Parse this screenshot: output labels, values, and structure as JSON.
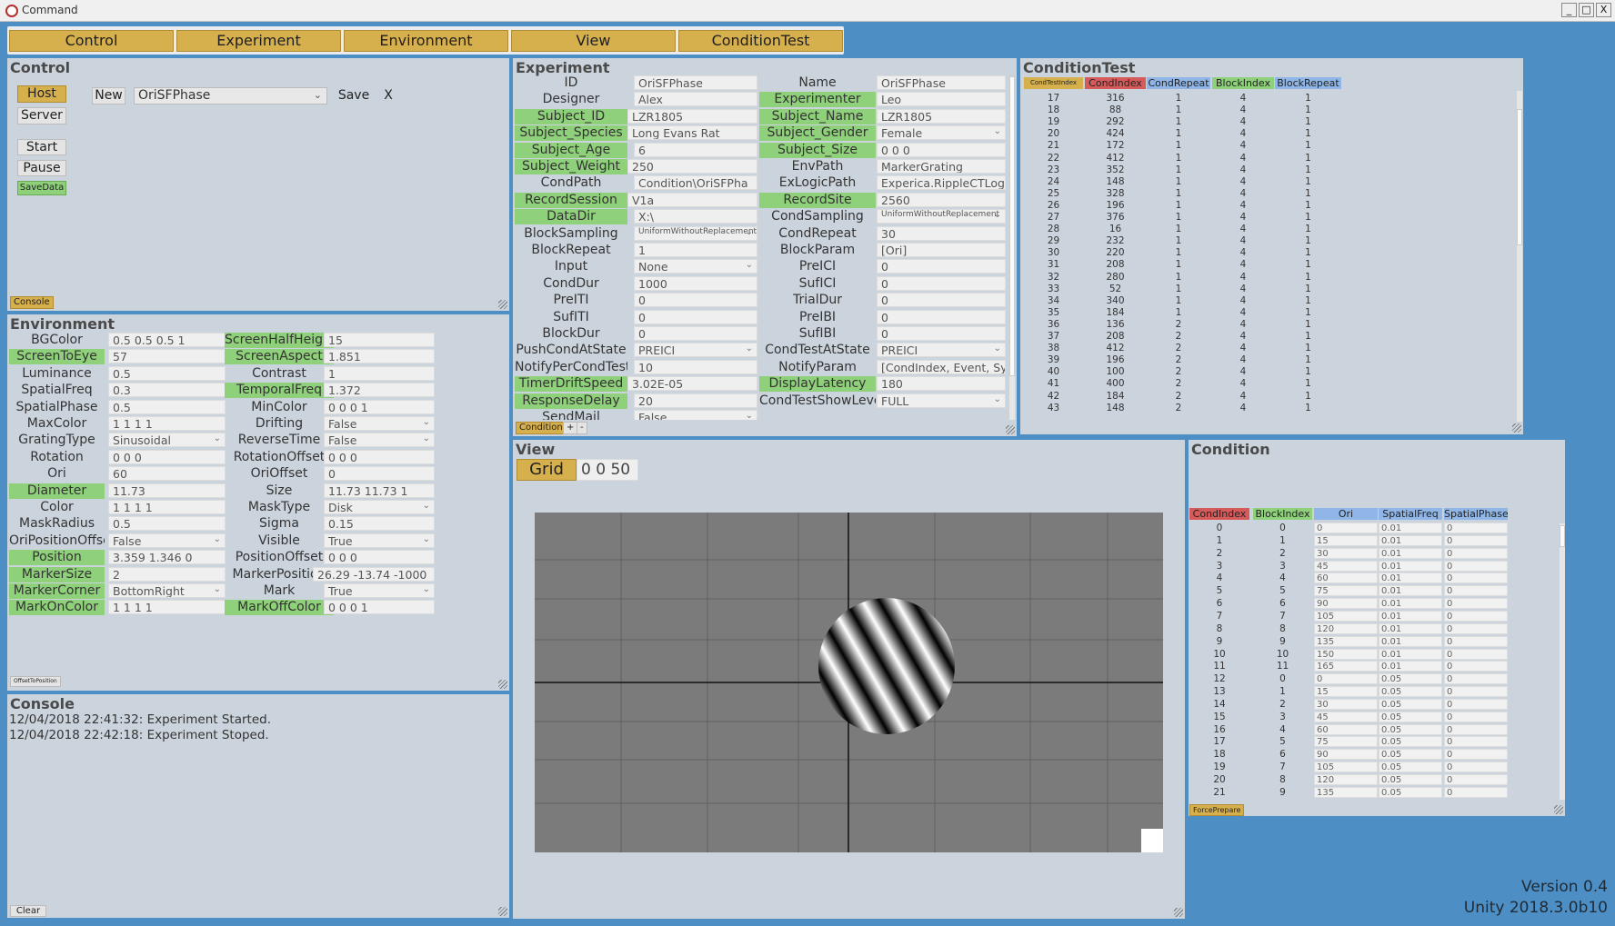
{
  "window": {
    "title": "Command",
    "min": "_",
    "max": "□",
    "close": "X"
  },
  "menu": [
    "Control",
    "Experiment",
    "Environment",
    "View",
    "ConditionTest"
  ],
  "control": {
    "title": "Control",
    "host": "Host",
    "server": "Server",
    "new": "New",
    "experiment": "OriSFPhase",
    "save": "Save",
    "close": "X",
    "start": "Start",
    "pause": "Pause",
    "savedata": "SaveData",
    "console_tab": "Console"
  },
  "environment": {
    "title": "Environment",
    "footer_tab": "OffsetToPosition",
    "rows": [
      [
        "BGColor",
        "0.5 0.5 0.5 1",
        false,
        "ScreenHalfHeight",
        "15",
        true
      ],
      [
        "ScreenToEye",
        "57",
        true,
        "ScreenAspect",
        "1.851",
        true
      ],
      [
        "Luminance",
        "0.5",
        false,
        "Contrast",
        "1",
        false
      ],
      [
        "SpatialFreq",
        "0.3",
        false,
        "TemporalFreq",
        "1.372",
        true
      ],
      [
        "SpatialPhase",
        "0.5",
        false,
        "MinColor",
        "0 0 0 1",
        false
      ],
      [
        "MaxColor",
        "1 1 1 1",
        false,
        "Drifting",
        "False",
        false
      ],
      [
        "GratingType",
        "Sinusoidal",
        false,
        "ReverseTime",
        "False",
        false
      ],
      [
        "Rotation",
        "0 0 0",
        false,
        "RotationOffset",
        "0 0 0",
        false
      ],
      [
        "Ori",
        "60",
        false,
        "OriOffset",
        "0",
        false
      ],
      [
        "Diameter",
        "11.73",
        true,
        "Size",
        "11.73 11.73 1",
        false
      ],
      [
        "Color",
        "1 1 1 1",
        false,
        "MaskType",
        "Disk",
        false
      ],
      [
        "MaskRadius",
        "0.5",
        false,
        "Sigma",
        "0.15",
        false
      ],
      [
        "OriPositionOffset",
        "False",
        false,
        "Visible",
        "True",
        false
      ],
      [
        "Position",
        "3.359 1.346 0",
        true,
        "PositionOffset",
        "0 0 0",
        false
      ],
      [
        "MarkerSize",
        "2",
        true,
        "MarkerPosition",
        "26.29 -13.74 -1000",
        false
      ],
      [
        "MarkerCorner",
        "BottomRight",
        true,
        "Mark",
        "True",
        false
      ],
      [
        "MarkOnColor",
        "1 1 1 1",
        true,
        "MarkOffColor",
        "0 0 0 1",
        true
      ]
    ]
  },
  "console": {
    "title": "Console",
    "lines": [
      "12/04/2018 22:41:32:  Experiment Started.",
      "12/04/2018 22:42:18:  Experiment Stoped."
    ],
    "clear": "Clear"
  },
  "experiment": {
    "title": "Experiment",
    "tab": "Condition",
    "plus": "+",
    "minus": "-",
    "rows": [
      [
        "ID",
        "OriSFPhase",
        false,
        "Name",
        "OriSFPhase",
        false
      ],
      [
        "Designer",
        "Alex",
        false,
        "Experimenter",
        "Leo",
        true
      ],
      [
        "Subject_ID",
        "LZR1805",
        true,
        "Subject_Name",
        "LZR1805",
        true
      ],
      [
        "Subject_Species",
        "Long Evans Rat",
        true,
        "Subject_Gender",
        "Female",
        true
      ],
      [
        "Subject_Age",
        "6",
        true,
        "Subject_Size",
        "0 0 0",
        true
      ],
      [
        "Subject_Weight",
        "250",
        true,
        "EnvPath",
        "MarkerGrating",
        false
      ],
      [
        "CondPath",
        "Condition\\OriSFPha",
        false,
        "ExLogicPath",
        "Experica.RippleCTLogic",
        false
      ],
      [
        "RecordSession",
        "V1a",
        true,
        "RecordSite",
        "2560",
        true
      ],
      [
        "DataDir",
        "X:\\",
        true,
        "CondSampling",
        "UniformWithoutReplacement",
        false
      ],
      [
        "BlockSampling",
        "UniformWithoutReplacement",
        false,
        "CondRepeat",
        "30",
        false
      ],
      [
        "BlockRepeat",
        "1",
        false,
        "BlockParam",
        "[Ori]",
        false
      ],
      [
        "Input",
        "None",
        false,
        "PreICI",
        "0",
        false
      ],
      [
        "CondDur",
        "1000",
        false,
        "SufICI",
        "0",
        false
      ],
      [
        "PreITI",
        "0",
        false,
        "TrialDur",
        "0",
        false
      ],
      [
        "SufITI",
        "0",
        false,
        "PreIBI",
        "0",
        false
      ],
      [
        "BlockDur",
        "0",
        false,
        "SufIBI",
        "0",
        false
      ],
      [
        "PushCondAtState",
        "PREICI",
        false,
        "CondTestAtState",
        "PREICI",
        false
      ],
      [
        "NotifyPerCondTest",
        "10",
        false,
        "NotifyParam",
        "[CondIndex, Event, SyncEve",
        false
      ],
      [
        "TimerDriftSpeed",
        "3.02E-05",
        true,
        "DisplayLatency",
        "180",
        true
      ],
      [
        "ResponseDelay",
        "20",
        true,
        "CondTestShowLevel",
        "FULL",
        false
      ],
      [
        "SendMail",
        "False",
        false,
        "",
        "",
        false
      ]
    ]
  },
  "conditiontest": {
    "title": "ConditionTest",
    "headers": [
      "CondTestIndex",
      "CondIndex",
      "CondRepeat",
      "BlockIndex",
      "BlockRepeat"
    ],
    "rows": [
      [
        17,
        316,
        1,
        4,
        1
      ],
      [
        18,
        88,
        1,
        4,
        1
      ],
      [
        19,
        292,
        1,
        4,
        1
      ],
      [
        20,
        424,
        1,
        4,
        1
      ],
      [
        21,
        172,
        1,
        4,
        1
      ],
      [
        22,
        412,
        1,
        4,
        1
      ],
      [
        23,
        352,
        1,
        4,
        1
      ],
      [
        24,
        148,
        1,
        4,
        1
      ],
      [
        25,
        328,
        1,
        4,
        1
      ],
      [
        26,
        196,
        1,
        4,
        1
      ],
      [
        27,
        376,
        1,
        4,
        1
      ],
      [
        28,
        16,
        1,
        4,
        1
      ],
      [
        29,
        232,
        1,
        4,
        1
      ],
      [
        30,
        220,
        1,
        4,
        1
      ],
      [
        31,
        208,
        1,
        4,
        1
      ],
      [
        32,
        280,
        1,
        4,
        1
      ],
      [
        33,
        52,
        1,
        4,
        1
      ],
      [
        34,
        340,
        1,
        4,
        1
      ],
      [
        35,
        184,
        1,
        4,
        1
      ],
      [
        36,
        136,
        2,
        4,
        1
      ],
      [
        37,
        208,
        2,
        4,
        1
      ],
      [
        38,
        412,
        2,
        4,
        1
      ],
      [
        39,
        196,
        2,
        4,
        1
      ],
      [
        40,
        100,
        2,
        4,
        1
      ],
      [
        41,
        400,
        2,
        4,
        1
      ],
      [
        42,
        184,
        2,
        4,
        1
      ],
      [
        43,
        148,
        2,
        4,
        1
      ]
    ]
  },
  "view": {
    "title": "View",
    "grid": "Grid",
    "grid_value": "0 0 50"
  },
  "condition": {
    "title": "Condition",
    "footer_tab": "ForcePrepare",
    "headers": [
      "CondIndex",
      "BlockIndex",
      "Ori",
      "SpatialFreq",
      "SpatialPhase"
    ],
    "rows": [
      [
        0,
        0,
        0,
        "0.01",
        0
      ],
      [
        1,
        1,
        15,
        "0.01",
        0
      ],
      [
        2,
        2,
        30,
        "0.01",
        0
      ],
      [
        3,
        3,
        45,
        "0.01",
        0
      ],
      [
        4,
        4,
        60,
        "0.01",
        0
      ],
      [
        5,
        5,
        75,
        "0.01",
        0
      ],
      [
        6,
        6,
        90,
        "0.01",
        0
      ],
      [
        7,
        7,
        105,
        "0.01",
        0
      ],
      [
        8,
        8,
        120,
        "0.01",
        0
      ],
      [
        9,
        9,
        135,
        "0.01",
        0
      ],
      [
        10,
        10,
        150,
        "0.01",
        0
      ],
      [
        11,
        11,
        165,
        "0.01",
        0
      ],
      [
        12,
        0,
        0,
        "0.05",
        0
      ],
      [
        13,
        1,
        15,
        "0.05",
        0
      ],
      [
        14,
        2,
        30,
        "0.05",
        0
      ],
      [
        15,
        3,
        45,
        "0.05",
        0
      ],
      [
        16,
        4,
        60,
        "0.05",
        0
      ],
      [
        17,
        5,
        75,
        "0.05",
        0
      ],
      [
        18,
        6,
        90,
        "0.05",
        0
      ],
      [
        19,
        7,
        105,
        "0.05",
        0
      ],
      [
        20,
        8,
        120,
        "0.05",
        0
      ],
      [
        21,
        9,
        135,
        "0.05",
        0
      ]
    ]
  },
  "footer": {
    "version": "Version 0.4",
    "unity": "Unity 2018.3.0b10"
  }
}
